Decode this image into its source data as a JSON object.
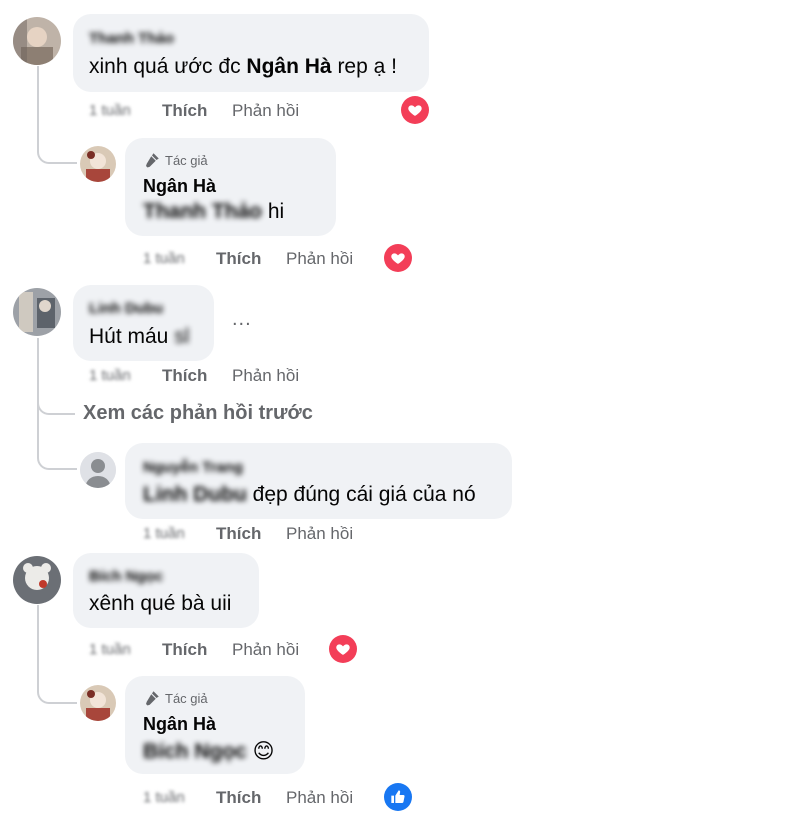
{
  "labels": {
    "like": "Thích",
    "reply": "Phản hồi",
    "author": "Tác giả",
    "view_previous": "Xem các phản hồi trước",
    "more": "..."
  },
  "comments": [
    {
      "name": "Thanh Thảo",
      "text_plain": "xinh quá ước đc",
      "text_bold": "Ngân Hà",
      "text_tail": " rep ạ !",
      "time": "1 tuần",
      "reaction": "heart-icon"
    },
    {
      "name": "Ngân Hà",
      "text_mention": "Thanh Thảo",
      "text_tail": " hi",
      "time": "1 tuần",
      "reaction": "heart-icon",
      "is_author": true
    },
    {
      "name": "Linh Dubu",
      "text_plain": "Hút máu",
      "text_blur": "sl",
      "time": "1 tuần"
    },
    {
      "name": "Nguyễn Trang",
      "text_mention": "Linh Dubu",
      "text_tail": " đẹp đúng cái giá của nó",
      "time": "1 tuần"
    },
    {
      "name": "Bích Ngọc",
      "text_plain": "xênh qué bà uii",
      "time": "1 tuần",
      "reaction": "heart-icon"
    },
    {
      "name": "Ngân Hà",
      "text_mention": "Bích Ngọc",
      "text_tail": " 😊",
      "time": "1 tuần",
      "reaction": "like-icon",
      "is_author": true
    }
  ]
}
